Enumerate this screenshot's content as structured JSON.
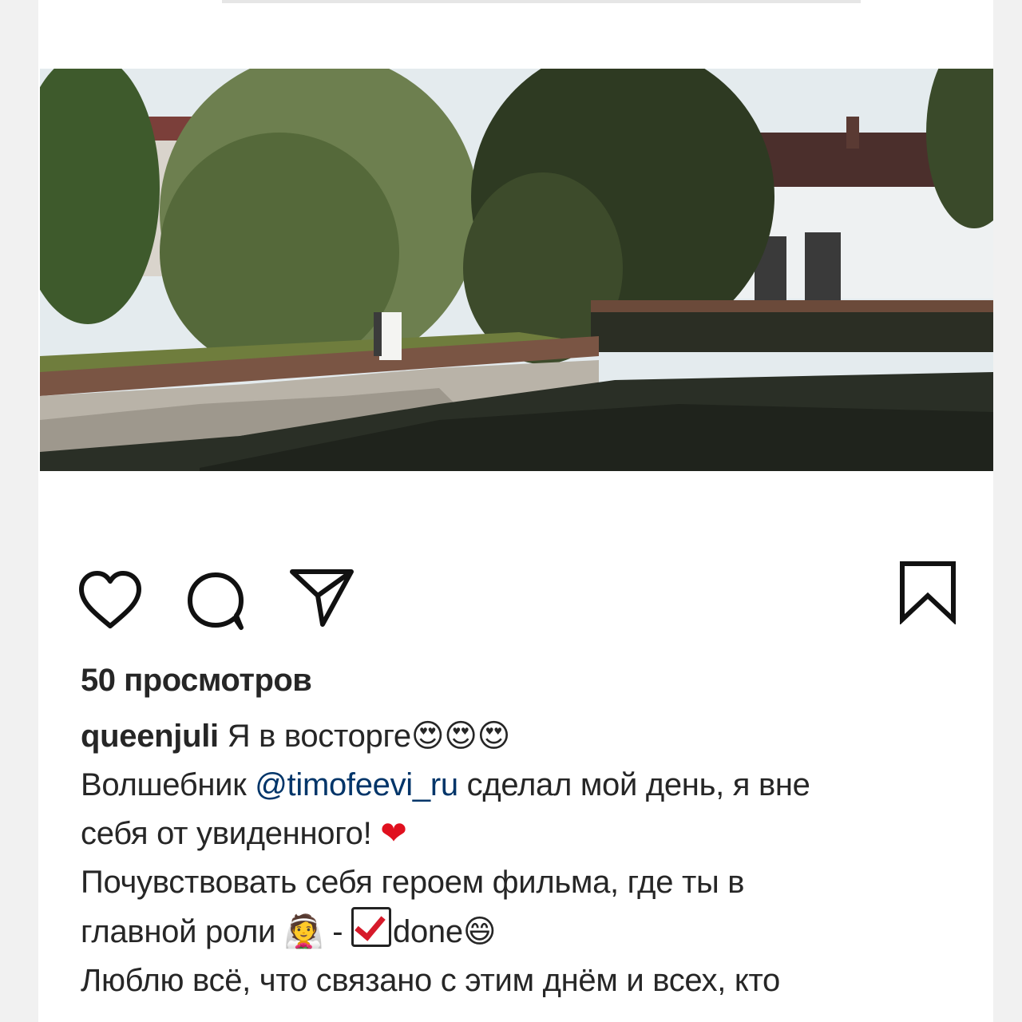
{
  "post": {
    "views_label": "50 просмотров",
    "username": "queenjuli",
    "caption_lines": {
      "line1_text": " Я в восторге",
      "line1_emojis": "😍😍😍",
      "line2_before": "Волшебник ",
      "line2_mention": "@timofeevi_ru",
      "line2_after": " сделал мой день, я вне",
      "line3_text": "себя от увиденного! ",
      "line3_emoji": "❤",
      "line4_text": "Почувствовать себя героем фильма, где ты в",
      "line5_text": "главной роли ",
      "line5_emoji": "👰",
      "line5_dash": " - ",
      "line5_done": "done",
      "line5_emoji_end": "😄",
      "line6_text": "Люблю всё, что связано с этим днём и всех, кто"
    }
  },
  "icons": {
    "like": "heart-icon",
    "comment": "comment-icon",
    "share": "paper-plane-icon",
    "save": "bookmark-icon"
  },
  "colors": {
    "text": "#262626",
    "mention": "#003569",
    "heart": "#e0101e"
  }
}
